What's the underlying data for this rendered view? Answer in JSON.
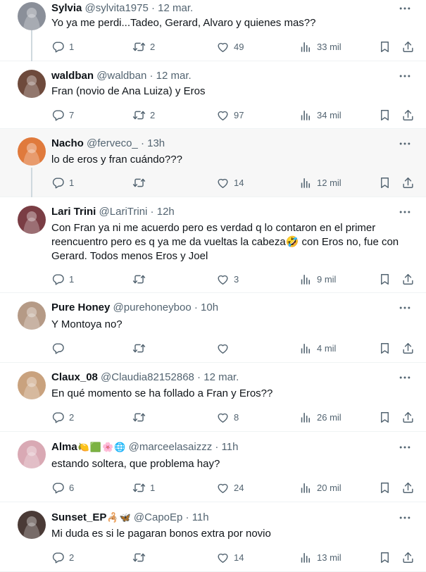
{
  "tweets": [
    {
      "name": "Sylvia",
      "emoji": [],
      "handle": "@sylvita1975",
      "time": "12 mar.",
      "text": "Yo ya me perdi...Tadeo, Gerard, Alvaro y quienes mas??",
      "replies": "1",
      "retweets": "2",
      "likes": "49",
      "views": "33 mil",
      "avatar_color": "#8a8f99"
    },
    {
      "name": "waldban",
      "emoji": [],
      "handle": "@waldban",
      "time": "12 mar.",
      "text": "Fran (novio de Ana Luiza) y Eros",
      "replies": "7",
      "retweets": "2",
      "likes": "97",
      "views": "34 mil",
      "avatar_color": "#6e4a3c"
    },
    {
      "name": "Nacho",
      "emoji": [],
      "handle": "@ferveco_",
      "time": "13h",
      "text": "lo de eros y fran cuándo???",
      "replies": "1",
      "retweets": "",
      "likes": "14",
      "views": "12 mil",
      "avatar_color": "#e07a3c"
    },
    {
      "name": "Lari Trini",
      "emoji": [],
      "handle": "@LariTrini",
      "time": "12h",
      "text": "Con Fran ya ni me acuerdo pero es verdad q lo contaron en el primer reencuentro pero es q ya me da vueltas la cabeza🤣 con Eros no, fue con Gerard. Todos menos Eros y Joel",
      "replies": "1",
      "retweets": "",
      "likes": "3",
      "views": "9 mil",
      "avatar_color": "#7a3d44"
    },
    {
      "name": "Pure Honey",
      "emoji": [],
      "handle": "@purehoneyboo",
      "time": "10h",
      "text": "Y Montoya no?",
      "replies": "",
      "retweets": "",
      "likes": "",
      "views": "4 mil",
      "avatar_color": "#b59a86"
    },
    {
      "name": "Claux_08",
      "emoji": [],
      "handle": "@Claudia82152868",
      "time": "12 mar.",
      "text": "En qué momento se ha follado a Fran y Eros??",
      "replies": "2",
      "retweets": "",
      "likes": "8",
      "views": "26 mil",
      "avatar_color": "#c9a27e"
    },
    {
      "name": "Alma",
      "emoji": [
        "🍋",
        "🟩",
        "🌸",
        "🌐"
      ],
      "handle": "@marceelasaizzz",
      "time": "11h",
      "text": "estando soltera, que problema hay?",
      "replies": "6",
      "retweets": "1",
      "likes": "24",
      "views": "20 mil",
      "avatar_color": "#d9a9b4"
    },
    {
      "name": "Sunset_EP",
      "emoji": [
        "🦂",
        "🦋"
      ],
      "handle": "@CapoEp",
      "time": "11h",
      "text": "Mi duda es si le pagaran bonos extra por novio",
      "replies": "2",
      "retweets": "",
      "likes": "14",
      "views": "13 mil",
      "avatar_color": "#4a3a36"
    }
  ],
  "icons": {
    "reply": "reply-icon",
    "retweet": "retweet-icon",
    "like": "heart-icon",
    "views": "views-icon",
    "bookmark": "bookmark-icon",
    "share": "share-icon",
    "more": "more-icon"
  },
  "colors": {
    "text": "#0f1419",
    "secondary": "#536471",
    "border": "#eff3f4",
    "thread": "#cfd9de",
    "highlight": "#f7f7f7"
  }
}
